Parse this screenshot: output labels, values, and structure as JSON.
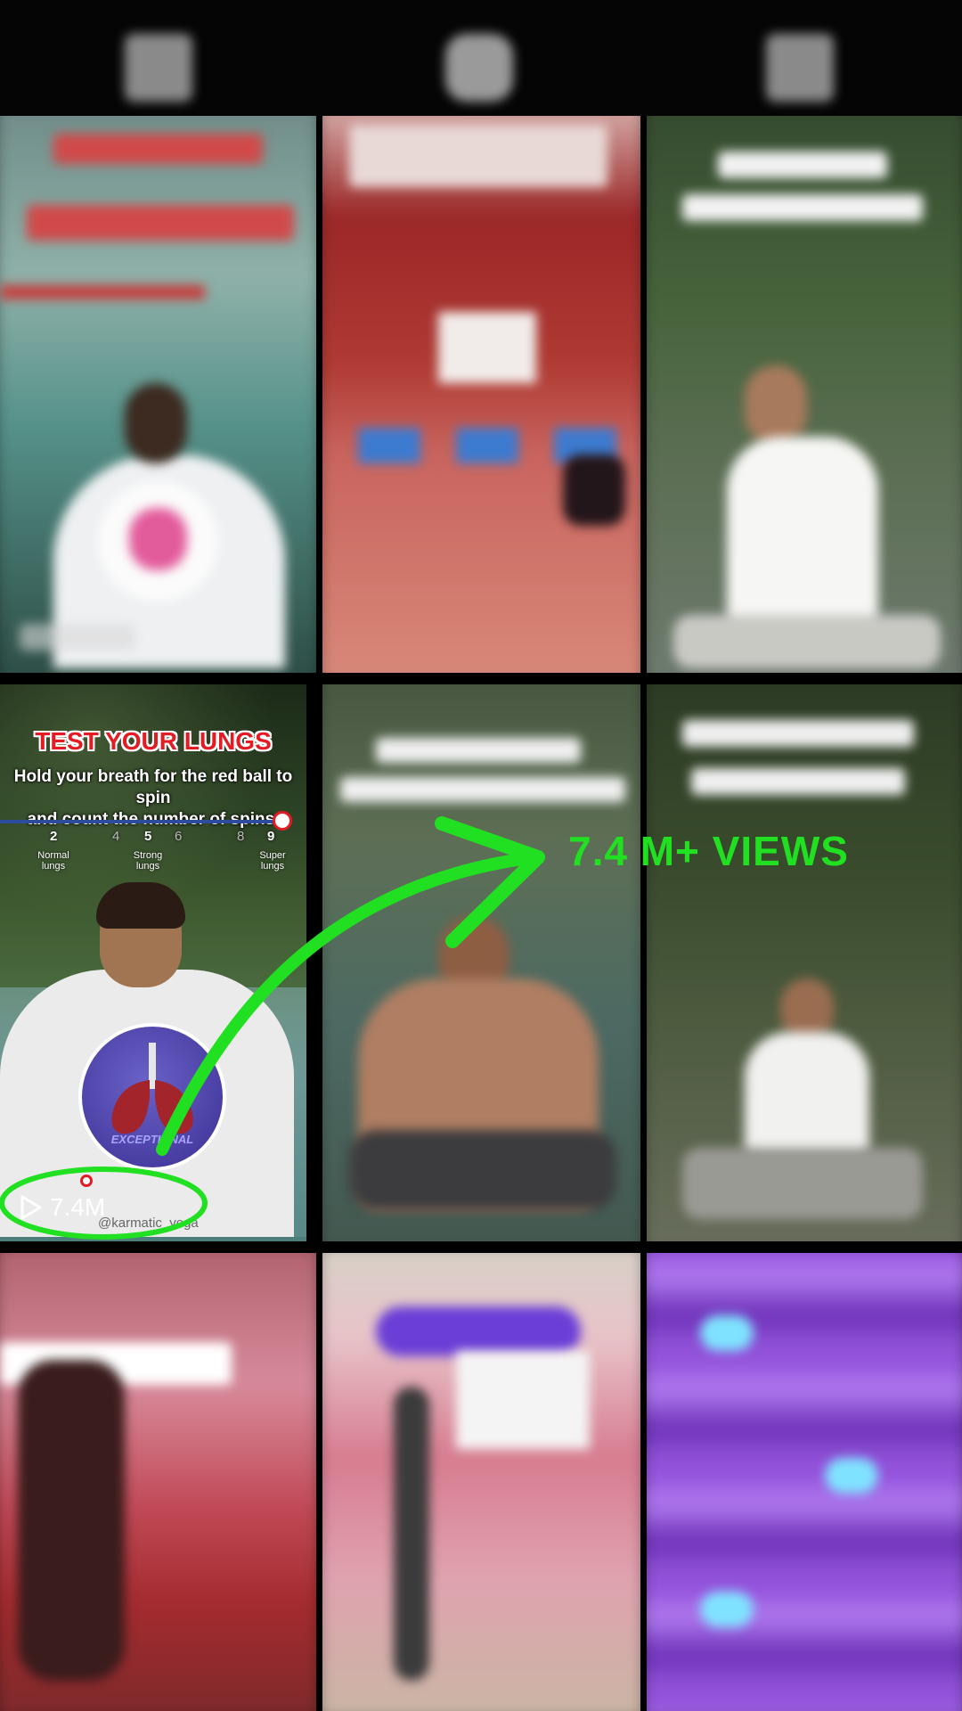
{
  "tabs": [
    {
      "name": "grid-icon"
    },
    {
      "name": "repost-icon"
    },
    {
      "name": "tagged-icon"
    }
  ],
  "tiles": [
    {
      "cover": "",
      "views": ""
    },
    {
      "cover": "",
      "views": ""
    },
    {
      "cover": "",
      "views": ""
    },
    {
      "cover_title": "TEST YOUR LUNGS",
      "cover_subtitle_1": "Hold your breath for the red ball to spin",
      "cover_subtitle_2": "and count the number of spins.",
      "scale": [
        {
          "num": "2",
          "caption_1": "Normal",
          "caption_2": "lungs"
        },
        {
          "num": "4",
          "caption_1": "",
          "caption_2": ""
        },
        {
          "num": "5",
          "caption_1": "Strong",
          "caption_2": "lungs"
        },
        {
          "num": "6",
          "caption_1": "",
          "caption_2": ""
        },
        {
          "num": "8",
          "caption_1": "",
          "caption_2": ""
        },
        {
          "num": "9",
          "caption_1": "Super",
          "caption_2": "lungs"
        }
      ],
      "badge_text": "EXCEPTIONAL",
      "handle": "@karmatic_yoga",
      "views": "7.4M"
    },
    {
      "cover": "",
      "views": ""
    },
    {
      "cover": "",
      "views": ""
    },
    {
      "cover": "",
      "views": ""
    },
    {
      "cover": "",
      "views": ""
    },
    {
      "cover": "",
      "views": ""
    }
  ],
  "annotation": {
    "text": "7.4 M+ VIEWS",
    "color": "#21e021"
  }
}
